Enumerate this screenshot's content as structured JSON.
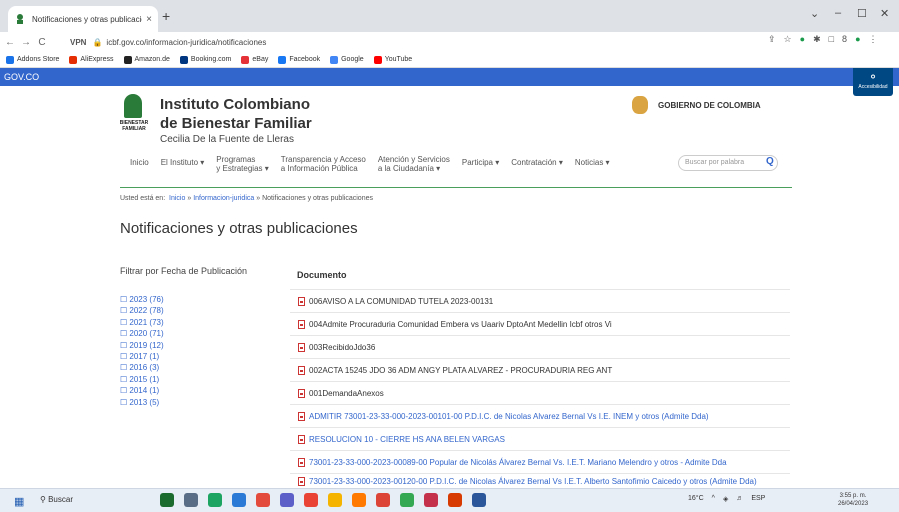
{
  "browser": {
    "tab_title": "Notificaciones y otras publicacio",
    "tab_close": "×",
    "new_tab": "+",
    "win_min": "–",
    "win_max": "☐",
    "win_close": "✕",
    "win_dropdown": "⌄",
    "url": "icbf.gov.co/informacion-juridica/notificaciones",
    "url_prefix": "VPN",
    "back": "←",
    "forward": "→",
    "reload": "C"
  },
  "bookmarks": [
    {
      "label": "Addons Store",
      "color": "#1a73e8"
    },
    {
      "label": "AliExpress",
      "color": "#e62e04"
    },
    {
      "label": "Amazon.de",
      "color": "#222222"
    },
    {
      "label": "Booking.com",
      "color": "#003580"
    },
    {
      "label": "eBay",
      "color": "#e53238"
    },
    {
      "label": "Facebook",
      "color": "#1877f2"
    },
    {
      "label": "Google",
      "color": "#4285f4"
    },
    {
      "label": "YouTube",
      "color": "#ff0000"
    }
  ],
  "gov": {
    "label": "GOV.CO",
    "accessibility": "Accesibilidad"
  },
  "header": {
    "logo_text": "BIENESTAR FAMILIAR",
    "org_line1": "Instituto Colombiano",
    "org_line2": "de Bienestar Familiar",
    "org_line3": "Cecilia De la Fuente de Lleras",
    "gobierno": "GOBIERNO DE COLOMBIA"
  },
  "menu": {
    "items": [
      {
        "label": "Inicio"
      },
      {
        "label": "El Instituto ▾"
      },
      {
        "label": "Programas",
        "label2": "y Estrategias ▾"
      },
      {
        "label": "Transparencia y Acceso",
        "label2": "a Información Pública"
      },
      {
        "label": "Atención y Servicios",
        "label2": "a la Ciudadanía ▾"
      },
      {
        "label": "Participa ▾"
      },
      {
        "label": "Contratación ▾"
      },
      {
        "label": "Noticias ▾"
      }
    ],
    "search_placeholder": "Buscar por palabra"
  },
  "breadcrumb": {
    "prefix": "Usted está en:",
    "home": "Inicio",
    "sep1": "»",
    "section": "Informacion-juridica",
    "sep2": "»",
    "current": "Notificaciones y otras publicaciones"
  },
  "page_title": "Notificaciones y otras publicaciones",
  "filter": {
    "title": "Filtrar por Fecha de Publicación",
    "years": [
      "2023 (76)",
      "2022 (78)",
      "2021 (73)",
      "2020 (71)",
      "2019 (12)",
      "2017 (1)",
      "2016 (3)",
      "2015 (1)",
      "2014 (1)",
      "2013 (5)"
    ]
  },
  "documents": {
    "header": "Documento",
    "items": [
      "006AVISO A LA COMUNIDAD TUTELA 2023-00131",
      "004Admite Procuraduria Comunidad Embera vs Uaariv DptoAnt Medellin Icbf otros Vi",
      "003RecibidoJdo36",
      "002ACTA 15245 JDO 36 ADM ANGY PLATA ALVAREZ - PROCURADURIA REG ANT",
      "001DemandaAnexos",
      "ADMITIR 73001-23-33-000-2023-00101-00 P.D.I.C. de Nicolas Alvarez Bernal Vs I.E. INEM y otros (Admite Dda)",
      "RESOLUCION 10 - CIERRE HS ANA BELEN VARGAS",
      "73001-23-33-000-2023-00089-00 Popular de Nicolás Álvarez Bernal Vs. I.E.T. Mariano Melendro y otros - Admite Dda",
      "73001-23-33-000-2023-00120-00 P.D.I.C. de Nicolas Álvarez Bernal Vs I.E.T. Alberto Santofimio Caicedo y otros (Admite Dda)"
    ]
  },
  "taskbar": {
    "search": "Buscar",
    "weather": "16°C",
    "lang": "ESP",
    "time": "3:55 p. m.",
    "date": "26/04/2023"
  }
}
